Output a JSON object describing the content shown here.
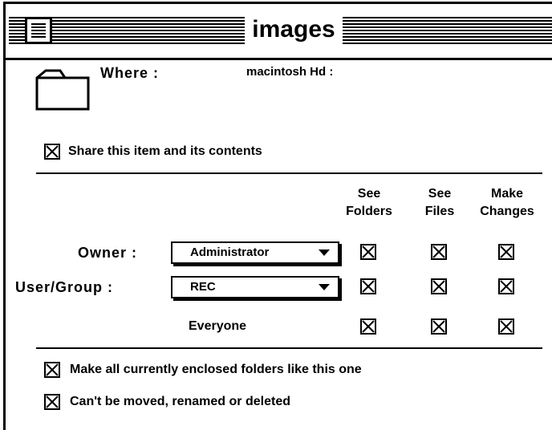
{
  "window": {
    "title": "images"
  },
  "where": {
    "label": "Where :",
    "value": "macintosh Hd :"
  },
  "share": {
    "label": "Share this item and its contents",
    "checked": true
  },
  "columns": [
    "See Folders",
    "See Files",
    "Make Changes"
  ],
  "columns_lines": [
    [
      "See",
      "Folders"
    ],
    [
      "See",
      "Files"
    ],
    [
      "Make",
      "Changes"
    ]
  ],
  "rows": [
    {
      "label": "Owner :",
      "select": "Administrator",
      "checks": [
        true,
        true,
        true
      ]
    },
    {
      "label": "User/Group :",
      "select": "REC",
      "checks": [
        true,
        true,
        true
      ]
    },
    {
      "label": "Everyone",
      "checks": [
        true,
        true,
        true
      ]
    }
  ],
  "options": [
    {
      "label": "Make all currently enclosed folders like this one",
      "checked": true
    },
    {
      "label": "Can't be moved, renamed or deleted",
      "checked": true
    }
  ],
  "icons": {
    "close": "close-box-icon",
    "folder": "folder-icon",
    "check": "x-checkbox-icon",
    "dropdown": "chevron-down-icon"
  }
}
